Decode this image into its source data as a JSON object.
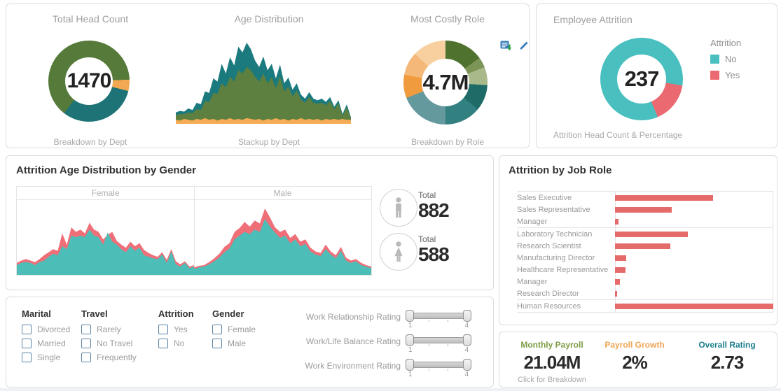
{
  "overview": {
    "head_count": {
      "title": "Total Head Count",
      "value": "1470",
      "caption": "Breakdown by Dept"
    },
    "age": {
      "title": "Age Distribution",
      "caption": "Stackup by Dept"
    },
    "costly_role": {
      "title": "Most Costly Role",
      "value": "4.7M",
      "caption": "Breakdown by Role"
    }
  },
  "employee_attrition": {
    "title": "Employee Attrition",
    "value": "237",
    "caption": "Attrition Head Count & Percentage",
    "legend_title": "Attrition",
    "legend": [
      {
        "label": "No",
        "color": "#4abfbf"
      },
      {
        "label": "Yes",
        "color": "#eb6a71"
      }
    ]
  },
  "gender_panel": {
    "title": "Attrition Age Distribution by Gender",
    "female_label": "Female",
    "male_label": "Male",
    "totals": [
      {
        "gender": "male",
        "label": "Total",
        "value": "882"
      },
      {
        "gender": "female",
        "label": "Total",
        "value": "588"
      }
    ]
  },
  "role_panel": {
    "title": "Attrition by Job Role"
  },
  "filters": {
    "groups": [
      {
        "title": "Marital",
        "options": [
          "Divorced",
          "Married",
          "Single"
        ]
      },
      {
        "title": "Travel",
        "options": [
          "Rarely",
          "No Travel",
          "Frequently"
        ]
      },
      {
        "title": "Attrition",
        "options": [
          "Yes",
          "No"
        ]
      },
      {
        "title": "Gender",
        "options": [
          "Female",
          "Male"
        ]
      }
    ],
    "sliders": [
      {
        "label": "Work Relationship Rating",
        "min": "1",
        "max": "4"
      },
      {
        "label": "Work/Life Balance Rating",
        "min": "1",
        "max": "4"
      },
      {
        "label": "Work Environment Rating",
        "min": "1",
        "max": "4"
      }
    ]
  },
  "kpis": [
    {
      "label": "Monthly Payroll",
      "value": "21.04M",
      "sub": "Click for Breakdown",
      "color": "#7d9c43"
    },
    {
      "label": "Payroll Growth",
      "value": "2%",
      "sub": "",
      "color": "#f0a454"
    },
    {
      "label": "Overall Rating",
      "value": "2.73",
      "sub": "",
      "color": "#1d7f8d"
    }
  ],
  "chart_data": [
    {
      "id": "head_count_donut",
      "type": "pie",
      "title": "Total Head Count",
      "center_value": "1470",
      "caption": "Breakdown by Dept",
      "note": "segment shares estimated from arc angles; no slice labels shown",
      "segments": [
        {
          "color": "#567a3a",
          "pct": 24.4
        },
        {
          "color": "#f2a852",
          "pct": 4.5
        },
        {
          "color": "#1e7376",
          "pct": 31.6
        },
        {
          "color": "#567a3a",
          "pct": 39.5
        }
      ]
    },
    {
      "id": "age_distribution",
      "type": "area",
      "title": "Age Distribution",
      "caption": "Stackup by Dept",
      "note": "axes unlabeled; heights normalized 0-1",
      "series": [
        {
          "name": "teal-top",
          "color": "#1b7a7d",
          "values": [
            0.14,
            0.16,
            0.15,
            0.19,
            0.17,
            0.26,
            0.24,
            0.4,
            0.38,
            0.56,
            0.52,
            0.74,
            0.62,
            0.82,
            0.72,
            0.95,
            0.88,
            1.0,
            0.92,
            0.78,
            0.7,
            0.83,
            0.66,
            0.74,
            0.56,
            0.73,
            0.5,
            0.57,
            0.42,
            0.5,
            0.36,
            0.31,
            0.39,
            0.31,
            0.29,
            0.31,
            0.27,
            0.33,
            0.21,
            0.29,
            0.12,
            0.24,
            0.08
          ]
        },
        {
          "name": "green-mid",
          "color": "#5d7f3f",
          "values": [
            0.11,
            0.12,
            0.12,
            0.14,
            0.13,
            0.18,
            0.17,
            0.28,
            0.27,
            0.38,
            0.37,
            0.5,
            0.45,
            0.58,
            0.52,
            0.66,
            0.62,
            0.7,
            0.66,
            0.58,
            0.52,
            0.62,
            0.5,
            0.57,
            0.44,
            0.58,
            0.4,
            0.46,
            0.34,
            0.41,
            0.3,
            0.26,
            0.33,
            0.26,
            0.25,
            0.26,
            0.23,
            0.28,
            0.18,
            0.25,
            0.1,
            0.2,
            0.07
          ]
        },
        {
          "name": "orange-base",
          "color": "#f5ac55",
          "values": [
            0.05,
            0.04,
            0.06,
            0.05,
            0.04,
            0.06,
            0.05,
            0.07,
            0.05,
            0.06,
            0.04,
            0.06,
            0.05,
            0.07,
            0.05,
            0.06,
            0.05,
            0.07,
            0.06,
            0.05,
            0.06,
            0.04,
            0.06,
            0.05,
            0.07,
            0.05,
            0.06,
            0.04,
            0.06,
            0.05,
            0.07,
            0.05,
            0.06,
            0.05,
            0.06,
            0.04,
            0.06,
            0.05,
            0.06,
            0.05,
            0.06,
            0.05,
            0.05
          ]
        }
      ]
    },
    {
      "id": "costly_role_donut",
      "type": "pie",
      "title": "Most Costly Role",
      "center_value": "4.7M",
      "caption": "Breakdown by Role",
      "note": "segment shares estimated from arc angles; no slice labels shown",
      "segments": [
        {
          "color": "#50722f",
          "pct": 15
        },
        {
          "color": "#7c9456",
          "pct": 4
        },
        {
          "color": "#a9b98a",
          "pct": 7
        },
        {
          "color": "#1e6b68",
          "pct": 10
        },
        {
          "color": "#338080",
          "pct": 14
        },
        {
          "color": "#649a9e",
          "pct": 19
        },
        {
          "color": "#f09b3e",
          "pct": 9
        },
        {
          "color": "#f4b878",
          "pct": 9
        },
        {
          "color": "#f8cf9f",
          "pct": 13
        }
      ]
    },
    {
      "id": "attrition_donut",
      "type": "pie",
      "title": "Employee Attrition",
      "center_value": "237",
      "caption": "Attrition Head Count & Percentage",
      "segments": [
        {
          "label": "No",
          "color": "#4abfbf",
          "pct": 27.5
        },
        {
          "label": "Yes",
          "color": "#eb6a71",
          "pct": 16.1
        },
        {
          "label": "No",
          "color": "#4abfbf",
          "pct": 56.4
        }
      ]
    },
    {
      "id": "female_attrition_area",
      "type": "area",
      "title": "Female",
      "total": 588,
      "note": "red=Yes behind, teal=No in front; heights normalized 0-1",
      "series": [
        {
          "name": "yes-red",
          "color": "#ef6f79",
          "values": [
            0.16,
            0.19,
            0.21,
            0.19,
            0.17,
            0.21,
            0.26,
            0.3,
            0.34,
            0.32,
            0.55,
            0.4,
            0.63,
            0.57,
            0.6,
            0.55,
            0.69,
            0.6,
            0.57,
            0.47,
            0.53,
            0.57,
            0.45,
            0.4,
            0.36,
            0.44,
            0.38,
            0.42,
            0.33,
            0.29,
            0.26,
            0.24,
            0.3,
            0.2,
            0.34,
            0.18,
            0.14,
            0.18,
            0.11,
            0.13
          ]
        },
        {
          "name": "no-teal",
          "color": "#4dbdb7",
          "values": [
            0.13,
            0.16,
            0.17,
            0.16,
            0.13,
            0.17,
            0.19,
            0.24,
            0.28,
            0.26,
            0.38,
            0.34,
            0.52,
            0.5,
            0.52,
            0.5,
            0.6,
            0.52,
            0.5,
            0.4,
            0.56,
            0.44,
            0.4,
            0.34,
            0.3,
            0.38,
            0.32,
            0.36,
            0.26,
            0.24,
            0.22,
            0.21,
            0.27,
            0.16,
            0.31,
            0.14,
            0.11,
            0.16,
            0.09,
            0.11
          ]
        }
      ]
    },
    {
      "id": "male_attrition_area",
      "type": "area",
      "title": "Male",
      "total": 882,
      "note": "red=Yes behind, teal=No in front; heights normalized 0-1",
      "series": [
        {
          "name": "yes-red",
          "color": "#ef6f79",
          "values": [
            0.1,
            0.12,
            0.13,
            0.17,
            0.22,
            0.28,
            0.37,
            0.42,
            0.57,
            0.62,
            0.7,
            0.64,
            0.72,
            0.68,
            0.88,
            0.76,
            0.63,
            0.57,
            0.6,
            0.49,
            0.54,
            0.44,
            0.47,
            0.36,
            0.31,
            0.29,
            0.4,
            0.31,
            0.26,
            0.37,
            0.23,
            0.19,
            0.21,
            0.16,
            0.13,
            0.11
          ]
        },
        {
          "name": "no-teal",
          "color": "#4dbdb7",
          "values": [
            0.08,
            0.1,
            0.11,
            0.14,
            0.18,
            0.23,
            0.3,
            0.35,
            0.47,
            0.52,
            0.57,
            0.54,
            0.6,
            0.57,
            0.74,
            0.64,
            0.56,
            0.49,
            0.52,
            0.42,
            0.47,
            0.38,
            0.41,
            0.31,
            0.27,
            0.25,
            0.34,
            0.27,
            0.22,
            0.32,
            0.19,
            0.16,
            0.18,
            0.13,
            0.11,
            0.09
          ]
        }
      ]
    },
    {
      "id": "attrition_by_role",
      "type": "bar",
      "title": "Attrition by Job Role",
      "note": "bars unlabeled; lengths recorded as % of axis width",
      "bar_color": "#e56a6a",
      "categories": [
        "Sales Executive",
        "Sales Representative",
        "Manager",
        "Laboratory Technician",
        "Research Scientist",
        "Manufacturing Director",
        "Healthcare Representative",
        "Manager",
        "Research Director",
        "Human Resources"
      ],
      "values_pct_of_max": [
        62,
        36,
        2,
        46,
        35,
        7,
        6.5,
        3,
        1.5,
        100
      ],
      "group_breaks_after": [
        2,
        8
      ]
    }
  ]
}
